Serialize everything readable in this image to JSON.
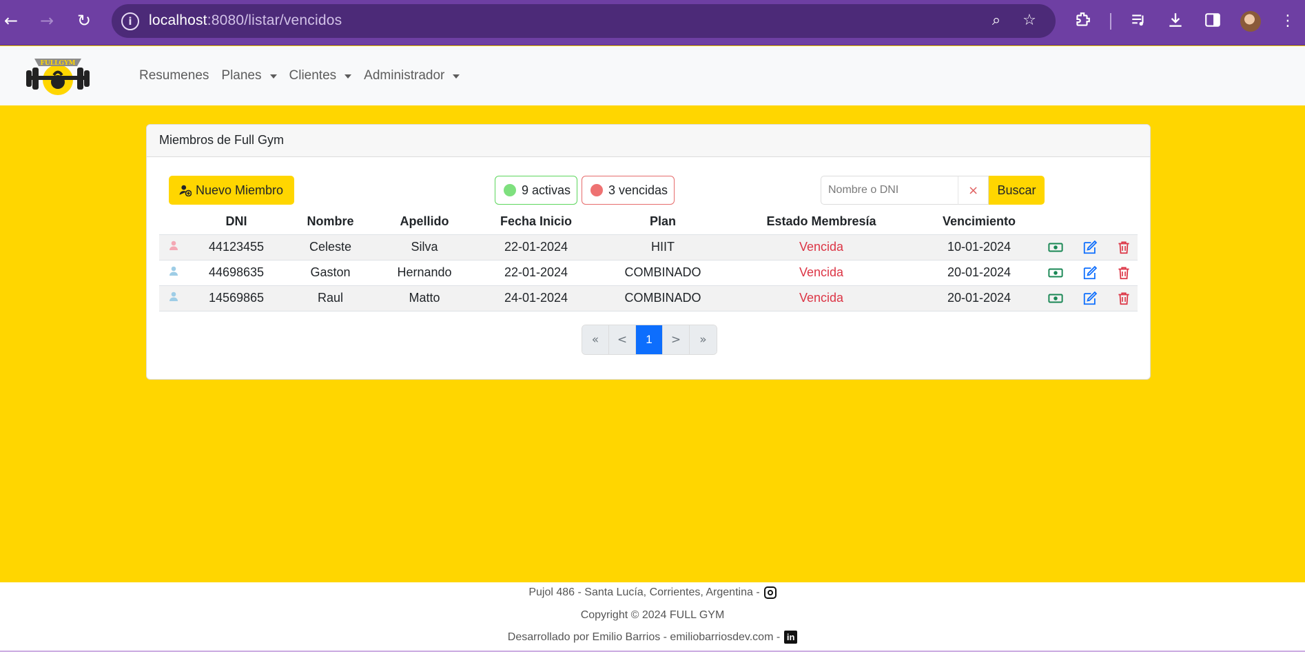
{
  "browser": {
    "url_host": "localhost",
    "url_rest": ":8080/listar/vencidos",
    "icons": [
      "back-arrow-icon",
      "forward-arrow-icon",
      "reload-icon",
      "site-info-icon",
      "zoom-icon",
      "bookmark-star-icon",
      "extensions-icon",
      "media-icon",
      "download-icon",
      "side-panel-icon",
      "profile-avatar",
      "menu-icon"
    ]
  },
  "nav": {
    "brand": "FULLGYM",
    "links": [
      {
        "label": "Resumenes"
      },
      {
        "label": "Planes"
      },
      {
        "label": "Clientes"
      },
      {
        "label": "Administrador"
      }
    ]
  },
  "card": {
    "header": "Miembros de Full Gym",
    "new_member_label": "Nuevo Miembro",
    "active_badge": "9 activas",
    "expired_badge": "3 vencidas",
    "search_placeholder": "Nombre o DNI",
    "search_clear": "×",
    "search_button": "Buscar"
  },
  "table": {
    "headers": [
      "DNI",
      "Nombre",
      "Apellido",
      "Fecha Inicio",
      "Plan",
      "Estado Membresía",
      "Vencimiento"
    ],
    "rows": [
      {
        "dni": "44123455",
        "nombre": "Celeste",
        "apellido": "Silva",
        "fecha_inicio": "22-01-2024",
        "plan": "HIIT",
        "estado": "Vencida",
        "vencimiento": "10-01-2024",
        "gender": "female"
      },
      {
        "dni": "44698635",
        "nombre": "Gaston",
        "apellido": "Hernando",
        "fecha_inicio": "22-01-2024",
        "plan": "COMBINADO",
        "estado": "Vencida",
        "vencimiento": "20-01-2024",
        "gender": "male"
      },
      {
        "dni": "14569865",
        "nombre": "Raul",
        "apellido": "Matto",
        "fecha_inicio": "24-01-2024",
        "plan": "COMBINADO",
        "estado": "Vencida",
        "vencimiento": "20-01-2024",
        "gender": "male"
      }
    ]
  },
  "pagination": {
    "first": "«",
    "prev": "<",
    "current": "1",
    "next": ">",
    "last": "»"
  },
  "footer": {
    "address": "Pujol 486 - Santa Lucía, Corrientes, Argentina -",
    "copyright": "Copyright © 2024 FULL GYM",
    "developer": "Desarrollado por Emilio Barrios - emiliobarriosdev.com -"
  },
  "colors": {
    "page_background": "#ffd600",
    "browser_frame": "#6e3fa3",
    "pay_action": "#198754",
    "edit_action": "#0d6efd",
    "delete_action": "#dc3545",
    "expired_text": "#dc3545",
    "active_dot": "#7ee07e",
    "expired_dot": "#ee7272",
    "female_icon": "#f4a8b4",
    "male_icon": "#9ecde6"
  }
}
